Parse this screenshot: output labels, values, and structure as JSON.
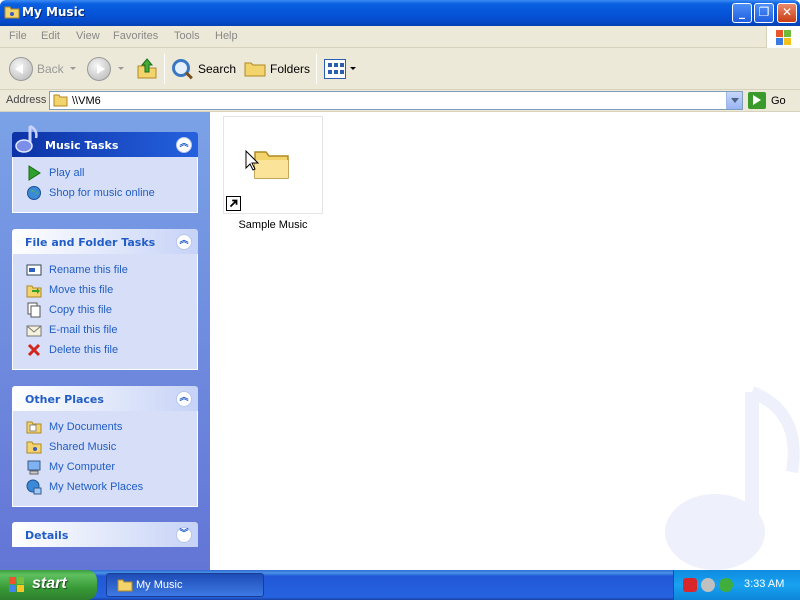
{
  "window": {
    "title": "My Music"
  },
  "menu": {
    "items": [
      "File",
      "Edit",
      "View",
      "Favorites",
      "Tools",
      "Help"
    ]
  },
  "toolbar": {
    "back_label": "Back",
    "search_label": "Search",
    "folders_label": "Folders"
  },
  "address": {
    "label": "Address",
    "value": "\\\\VM6",
    "go_label": "Go"
  },
  "sidebar": {
    "music_tasks": {
      "title": "Music Tasks",
      "items": [
        {
          "label": "Play all",
          "icon": "play-icon"
        },
        {
          "label": "Shop for music online",
          "icon": "globe-icon"
        }
      ]
    },
    "file_tasks": {
      "title": "File and Folder Tasks",
      "items": [
        {
          "label": "Rename this file",
          "icon": "rename-icon"
        },
        {
          "label": "Move this file",
          "icon": "move-icon"
        },
        {
          "label": "Copy this file",
          "icon": "copy-icon"
        },
        {
          "label": "E-mail this file",
          "icon": "email-icon"
        },
        {
          "label": "Delete this file",
          "icon": "delete-icon"
        }
      ]
    },
    "other_places": {
      "title": "Other Places",
      "items": [
        {
          "label": "My Documents",
          "icon": "my-documents-icon"
        },
        {
          "label": "Shared Music",
          "icon": "shared-music-icon"
        },
        {
          "label": "My Computer",
          "icon": "my-computer-icon"
        },
        {
          "label": "My Network Places",
          "icon": "network-places-icon"
        }
      ]
    },
    "details": {
      "title": "Details"
    }
  },
  "content": {
    "items": [
      {
        "label": "Sample Music",
        "icon": "folder-shortcut-icon"
      }
    ]
  },
  "taskbar": {
    "start_label": "start",
    "window_label": "My Music",
    "clock": "3:33 AM"
  },
  "colors": {
    "title_blue": "#0553d8",
    "taskpane_blue": "#6375d6",
    "link_blue": "#215dc6",
    "start_green": "#379a37"
  }
}
